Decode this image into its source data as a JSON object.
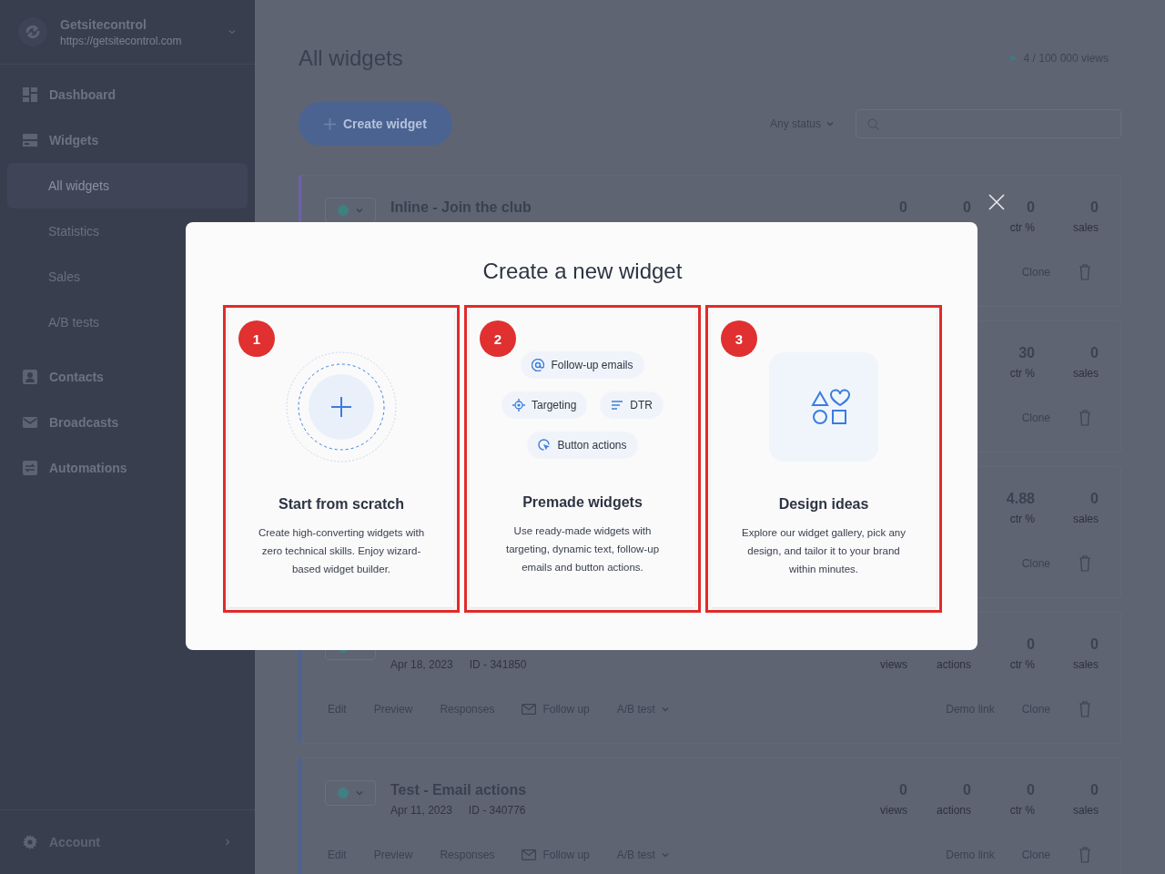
{
  "sidebar": {
    "brand": {
      "name": "Getsitecontrol",
      "url": "https://getsitecontrol.com"
    },
    "items": [
      {
        "label": "Dashboard",
        "kind": "dashboard",
        "selected": false
      },
      {
        "label": "Widgets",
        "kind": "widgets",
        "selected": false,
        "children": [
          {
            "label": "All widgets",
            "selected": true
          },
          {
            "label": "Statistics",
            "selected": false
          },
          {
            "label": "Sales",
            "selected": false
          },
          {
            "label": "A/B tests",
            "selected": false
          }
        ]
      },
      {
        "label": "Contacts",
        "kind": "contacts",
        "selected": false
      },
      {
        "label": "Broadcasts",
        "kind": "broadcasts",
        "selected": false
      },
      {
        "label": "Automations",
        "kind": "automations",
        "selected": false
      }
    ],
    "account": "Account"
  },
  "header": {
    "title": "All widgets",
    "views": "4 / 100 000 views",
    "create_button": "Create widget",
    "status_filter": "Any status"
  },
  "widgets": [
    {
      "color": "#6a62a8",
      "status": {
        "color": "#3f8080"
      },
      "title": "Inline - Join the club",
      "stats": [
        {
          "value": "0"
        },
        {
          "value": "0"
        },
        {
          "value": "0",
          "label": "ctr %"
        },
        {
          "value": "0",
          "label": "sales"
        }
      ],
      "actions_right": [
        {
          "label": "Clone",
          "kind": "link"
        }
      ]
    },
    {
      "stats": [
        {
          "value": "30",
          "label": "ctr %"
        },
        {
          "value": "0",
          "label": "sales"
        }
      ],
      "actions_right": [
        {
          "label": "Clone",
          "kind": "link"
        }
      ]
    },
    {
      "stats": [
        {
          "value": "4.88",
          "label": "ctr %"
        },
        {
          "value": "0",
          "label": "sales"
        }
      ],
      "actions_right": [
        {
          "label": "Clone",
          "kind": "link"
        }
      ]
    },
    {
      "color": "#4a6296",
      "status": {
        "color": "#3f8080"
      },
      "date": "Apr 18, 2023",
      "id": "ID - 341850",
      "stats": [
        {
          "label": "views"
        },
        {
          "label": "actions"
        },
        {
          "value": "0",
          "label": "ctr %"
        },
        {
          "value": "0",
          "label": "sales"
        }
      ],
      "actions_left": [
        {
          "label": "Edit",
          "kind": "link"
        },
        {
          "label": "Preview",
          "kind": "link"
        },
        {
          "label": "Responses",
          "kind": "link"
        },
        {
          "label": "Follow up",
          "kind": "mail"
        },
        {
          "label": "A/B test",
          "kind": "dropdown"
        }
      ],
      "actions_right": [
        {
          "label": "Demo link",
          "kind": "link"
        },
        {
          "label": "Clone",
          "kind": "link"
        }
      ]
    },
    {
      "color": "#4a6296",
      "status": {
        "color": "#3f8080"
      },
      "title": "Test - Email actions",
      "date": "Apr 11, 2023",
      "id": "ID - 340776",
      "stats": [
        {
          "value": "0",
          "label": "views"
        },
        {
          "value": "0",
          "label": "actions"
        },
        {
          "value": "0",
          "label": "ctr %"
        },
        {
          "value": "0",
          "label": "sales"
        }
      ],
      "actions_left": [
        {
          "label": "Edit",
          "kind": "link"
        },
        {
          "label": "Preview",
          "kind": "link"
        },
        {
          "label": "Responses",
          "kind": "link"
        },
        {
          "label": "Follow up",
          "kind": "mail"
        },
        {
          "label": "A/B test",
          "kind": "dropdown"
        }
      ],
      "actions_right": [
        {
          "label": "Demo link",
          "kind": "link"
        },
        {
          "label": "Clone",
          "kind": "link"
        }
      ]
    }
  ],
  "modal": {
    "title": "Create a new widget",
    "options": [
      {
        "number": "1",
        "kind": "scratch",
        "title": "Start from scratch",
        "description": "Create high-converting widgets with zero technical skills. Enjoy wizard-based widget builder."
      },
      {
        "number": "2",
        "kind": "premade",
        "title": "Premade widgets",
        "description": "Use ready-made widgets with targeting, dynamic text, follow-up emails and button actions.",
        "chip_rows": [
          [
            {
              "label": "Follow-up emails",
              "kind": "email"
            }
          ],
          [
            {
              "label": "Targeting",
              "kind": "targeting"
            },
            {
              "label": "DTR",
              "kind": "text"
            }
          ],
          [
            {
              "label": "Button actions",
              "kind": "action"
            }
          ]
        ]
      },
      {
        "number": "3",
        "kind": "ideas",
        "title": "Design ideas",
        "description": "Explore our widget gallery, pick any design, and tailor it to your brand within minutes."
      }
    ]
  }
}
